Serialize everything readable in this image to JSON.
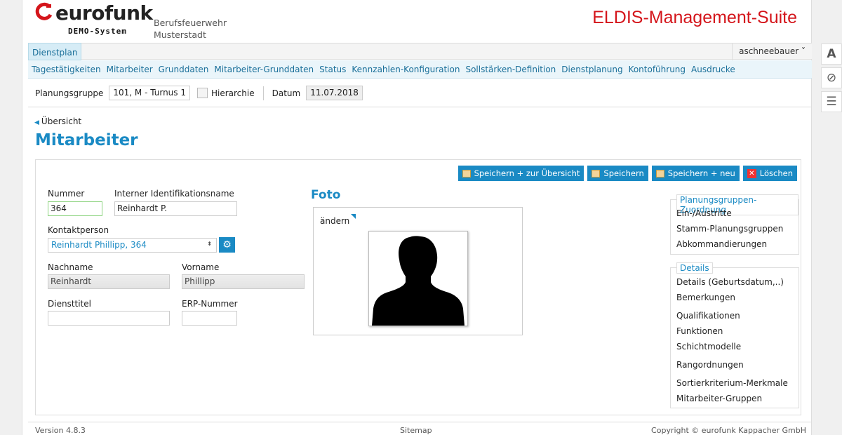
{
  "header": {
    "logo_text": "eurofunk",
    "logo_sub": "DEMO-System",
    "org_line1": "Berufsfeuerwehr",
    "org_line2": "Musterstadt",
    "suite_title": "ELDIS-Management-Suite"
  },
  "nav": {
    "active_tab": "Dienstplan",
    "user": "aschneebauer",
    "user_caret": "˅",
    "menu": [
      "Tagestätigkeiten",
      "Mitarbeiter",
      "Grunddaten",
      "Mitarbeiter-Grunddaten",
      "Status",
      "Kennzahlen-Konfiguration",
      "Sollstärken-Definition",
      "Dienstplanung",
      "Kontoführung",
      "Ausdrucke"
    ]
  },
  "filter": {
    "planungsgruppe_label": "Planungsgruppe",
    "planungsgruppe_value": "101, M - Turnus 1",
    "hierarchie_label": "Hierarchie",
    "datum_label": "Datum",
    "datum_value": "11.07.2018"
  },
  "page": {
    "back_label": "Übersicht",
    "title": "Mitarbeiter"
  },
  "buttons": {
    "save_overview": "Speichern + zur Übersicht",
    "save": "Speichern",
    "save_new": "Speichern + neu",
    "delete": "Löschen",
    "delete_glyph": "✕"
  },
  "form": {
    "nummer_label": "Nummer",
    "nummer_value": "364",
    "intern_label": "Interner Identifikationsname",
    "intern_value": "Reinhardt P.",
    "kontakt_label": "Kontaktperson",
    "kontakt_value": "Reinhardt Phillipp, 364",
    "gear_glyph": "⚙",
    "caret_glyph": "⬍",
    "nachname_label": "Nachname",
    "nachname_value": "Reinhardt",
    "vorname_label": "Vorname",
    "vorname_value": "Phillipp",
    "diensttitel_label": "Diensttitel",
    "diensttitel_value": "",
    "erp_label": "ERP-Nummer",
    "erp_value": ""
  },
  "foto": {
    "heading": "Foto",
    "change_label": "ändern"
  },
  "side": {
    "group1_title": "Planungsgruppen-Zuordnung",
    "group1_items": [
      "Ein-/Austritte",
      "Stamm-Planungsgruppen",
      "Abkommandierungen"
    ],
    "group2_title": "Details",
    "group2_items": [
      "Details (Geburtsdatum,..)",
      "Bemerkungen",
      "Qualifikationen",
      "Funktionen",
      "Schichtmodelle",
      "Rangordnungen",
      "Sortierkriterium-Merkmale",
      "Mitarbeiter-Gruppen"
    ]
  },
  "footer": {
    "version": "Version 4.8.3",
    "sitemap": "Sitemap",
    "copyright": "Copyright © eurofunk Kappacher GmbH"
  },
  "colors": {
    "accent": "#1a8ac4",
    "brand_red": "#d4151b"
  },
  "tools": {
    "font_icon": "A",
    "hide_icon": "⊘",
    "list_icon": "☰"
  }
}
